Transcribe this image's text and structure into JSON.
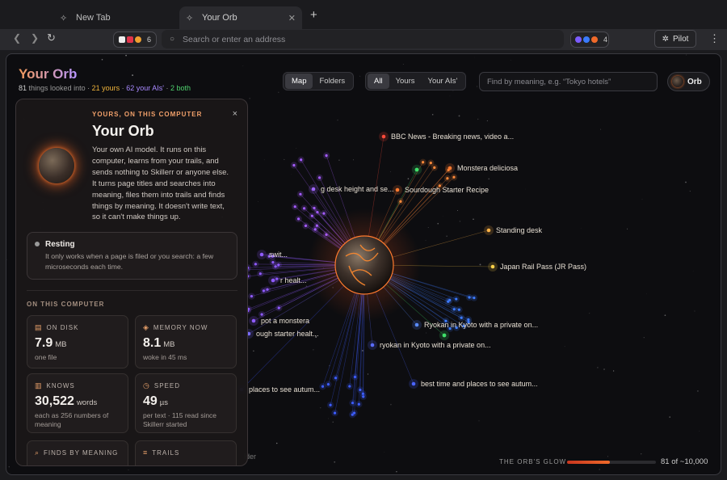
{
  "browser": {
    "tabs": [
      {
        "label": "New Tab",
        "icon": "sparkle-icon",
        "active": false
      },
      {
        "label": "Your Orb",
        "icon": "sparkle-icon",
        "active": true
      }
    ],
    "new_tab_glyph": "+",
    "address_placeholder": "Search or enter an address",
    "extensions_count": "6",
    "extensions2_count": "4",
    "pilot_label": "Pilot"
  },
  "header": {
    "title": "Your Orb",
    "stats_count": "81",
    "stats_text": "things looked into",
    "stats_yours": "21 yours",
    "stats_ais": "62 your AIs'",
    "stats_both": "2 both",
    "sep": "·"
  },
  "view_toggle": {
    "map": "Map",
    "folders": "Folders",
    "selected": "Map"
  },
  "filter_toggle": {
    "all": "All",
    "yours": "Yours",
    "ais": "Your AIs'",
    "selected": "All"
  },
  "search": {
    "placeholder": "Find by meaning, e.g. “Tokyo hotels”"
  },
  "orb_button": {
    "label": "Orb"
  },
  "graph_labels": [
    {
      "text": "BBC News - Breaking news, video a..."
    },
    {
      "text": "Monstera deliciosa"
    },
    {
      "text": "Sourdough Starter Recipe"
    },
    {
      "text": "Standing desk"
    },
    {
      "text": "Japan Rail Pass (JR Pass)"
    },
    {
      "text": "Ryokan in Kyoto with a private on..."
    },
    {
      "text": "ryokan in Kyoto with a private on..."
    },
    {
      "text": "best time and places to see autum..."
    },
    {
      "text": "places to see autum..."
    },
    {
      "text": "g desk height and se..."
    },
    {
      "text": "r healt..."
    },
    {
      "text": "swit..."
    },
    {
      "text": "pot a monstera"
    },
    {
      "text": "ough starter healt..."
    }
  ],
  "colors": {
    "accent": "#f06a2a",
    "mine": "#ffb347",
    "ai": "#8f5bff",
    "both": "#3fe06a",
    "blue": "#3d7bff"
  },
  "footer": {
    "glow_label": "THE ORB'S GLOW",
    "glow_fraction": 0.48,
    "glow_count": "81 of ~10,000",
    "folder_hint": "lder"
  },
  "panel": {
    "close_glyph": "×",
    "kicker": "YOURS, ON THIS COMPUTER",
    "title": "Your Orb",
    "description": "Your own AI model. It runs on this computer, learns from your trails, and sends nothing to Skillerr or anyone else. It turns page titles and searches into meaning, files them into trails and finds things by meaning. It doesn't write text, so it can't make things up.",
    "status_title": "Resting",
    "status_desc": "It only works when a page is filed or you search: a few microseconds each time.",
    "section_label": "ON THIS COMPUTER",
    "cards": [
      {
        "label": "ON DISK",
        "icon": "file-icon",
        "value": "7.9",
        "unit": "MB",
        "sub": "one file"
      },
      {
        "label": "MEMORY NOW",
        "icon": "stack-icon",
        "value": "8.1",
        "unit": "MB",
        "sub": "woke in 45 ms"
      },
      {
        "label": "KNOWS",
        "icon": "book-icon",
        "value": "30,522",
        "unit": "words",
        "sub": "each as 256 numbers of meaning"
      },
      {
        "label": "SPEED",
        "icon": "clock-icon",
        "value": "49",
        "unit": "µs",
        "sub": "per text · 115 read since Skillerr started"
      },
      {
        "label": "FINDS BY MEANING",
        "icon": "search-icon",
        "value": "",
        "unit": "",
        "sub": ""
      },
      {
        "label": "TRAILS",
        "icon": "trail-icon",
        "value": "",
        "unit": "",
        "sub": ""
      }
    ]
  }
}
